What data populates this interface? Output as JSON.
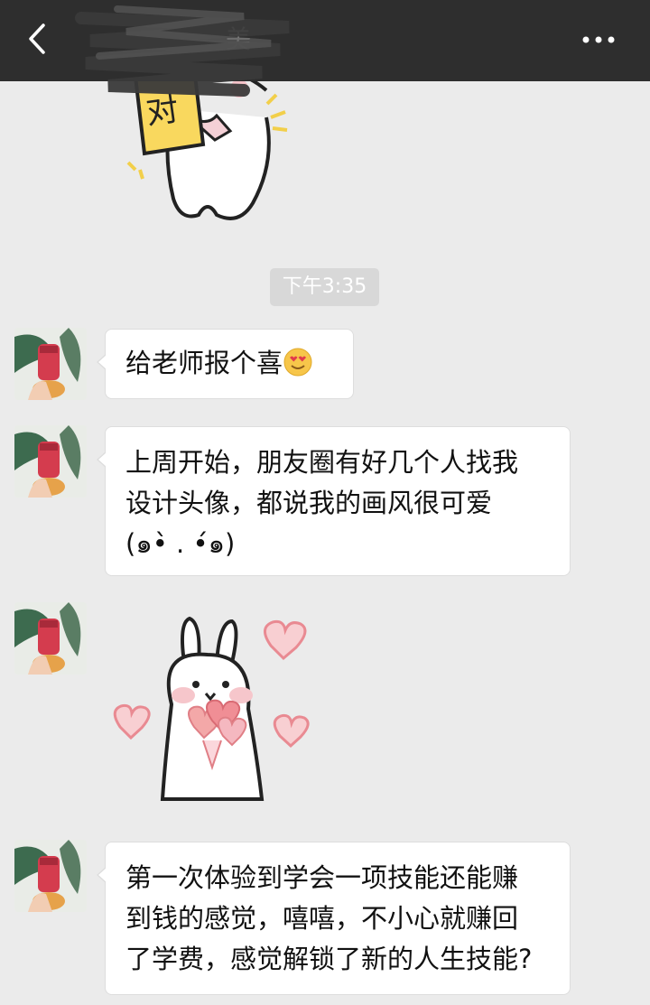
{
  "header": {
    "title": "美",
    "back_icon": "chevron-left-icon",
    "more_icon": "more-dots-icon",
    "background": "#2e2e2e"
  },
  "sticker_top": {
    "sign_text": "对"
  },
  "timestamp": "下午3:35",
  "messages": [
    {
      "type": "text",
      "text": "给老师报个喜",
      "emoji": "heart-eyes-emoji"
    },
    {
      "type": "text",
      "lines": [
        "上周开始，朋友圈有好几个人找我",
        "设计头像，都说我的画风很可爱",
        "(๑•̀ . •́๑)"
      ]
    },
    {
      "type": "sticker",
      "sticker": "bunny-holding-hearts-sticker"
    },
    {
      "type": "text",
      "lines": [
        "第一次体验到学会一项技能还能赚",
        "到钱的感觉，嘻嘻，不小心就赚回",
        "了学费，感觉解锁了新的人生技能?"
      ]
    }
  ],
  "colors": {
    "chat_background": "#ebebeb",
    "bubble": "#ffffff",
    "timestamp_bg": "#d8d8d8"
  }
}
